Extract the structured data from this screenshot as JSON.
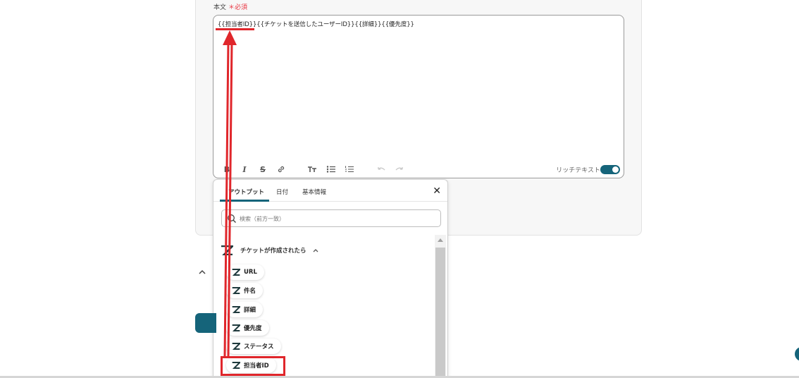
{
  "field": {
    "label": "本文",
    "required": "＊必須"
  },
  "editor": {
    "content": "{{担当者ID}}{{チケットを送信したユーザーID}}{{詳細}}{{優先度}}"
  },
  "toolbar": {
    "bold": "B",
    "italic": "I",
    "strike": "S",
    "rich_text_label": "リッチテキスト",
    "rich_text_enabled": true
  },
  "popup": {
    "tabs": [
      {
        "label": "アウトプット",
        "active": true
      },
      {
        "label": "日付",
        "active": false
      },
      {
        "label": "基本情報",
        "active": false
      }
    ],
    "search_placeholder": "検索（前方一致）",
    "group": {
      "title": "チケットが作成されたら",
      "icon": "zendesk-logo-icon",
      "items": [
        "URL",
        "件名",
        "詳細",
        "優先度",
        "ステータス",
        "担当者ID"
      ]
    },
    "highlighted_item": "担当者ID"
  },
  "colors": {
    "accent": "#15647a",
    "annotation": "#e0262b",
    "required": "#e8333f"
  }
}
